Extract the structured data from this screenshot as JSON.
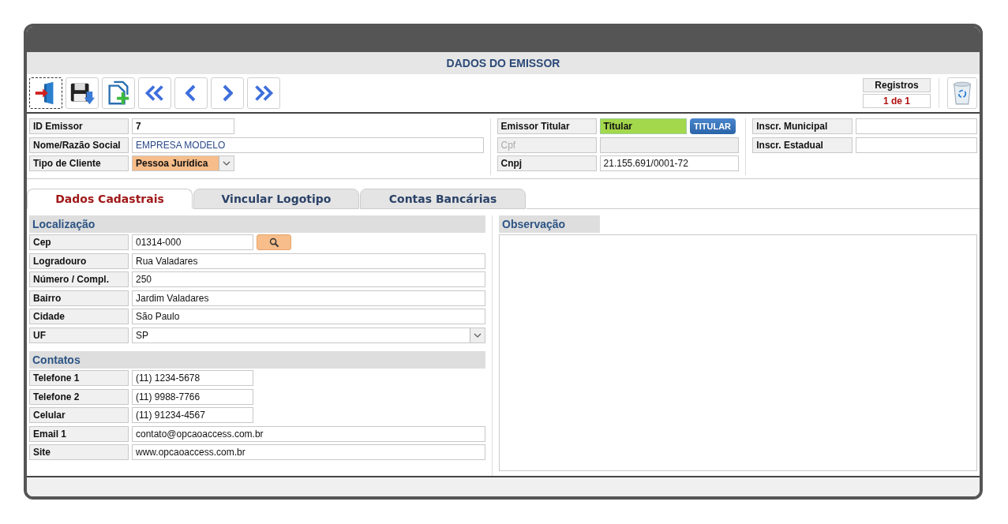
{
  "window": {
    "title": "DADOS DO EMISSOR"
  },
  "toolbar": [
    {
      "kind": "exit",
      "focused": true
    },
    {
      "kind": "save",
      "focused": false
    },
    {
      "kind": "new",
      "focused": false
    },
    {
      "kind": "first",
      "focused": false
    },
    {
      "kind": "prev",
      "focused": false
    },
    {
      "kind": "next",
      "focused": false
    },
    {
      "kind": "last",
      "focused": false
    }
  ],
  "records": {
    "label": "Registros",
    "value": "1 de 1"
  },
  "header": [
    {
      "fields": [
        {
          "label": "ID Emissor",
          "value": "7",
          "kind": "short",
          "disabled": false
        },
        {
          "label": "Nome/Razão Social",
          "value": "EMPRESA MODELO",
          "kind": "long",
          "disabled": false
        },
        {
          "label": "Tipo de Cliente",
          "value": "Pessoa Jurídica",
          "kind": "select",
          "color": "#f7bd8a",
          "disabled": false
        }
      ]
    },
    {
      "fields": [
        {
          "label": "Emissor Titular",
          "value": "Titular",
          "kind": "badge",
          "color": "#a4d84c",
          "button": "TITULAR",
          "disabled": false
        },
        {
          "label": "Cpf",
          "kind": "long",
          "disabled": true
        },
        {
          "label": "Cnpj",
          "value": "21.155.691/0001-72",
          "kind": "long",
          "disabled": false
        }
      ]
    },
    {
      "fields": [
        {
          "label": "Inscr. Municipal",
          "kind": "long",
          "disabled": false
        },
        {
          "label": "Inscr. Estadual",
          "kind": "long",
          "disabled": false
        }
      ]
    }
  ],
  "tabs": [
    {
      "label": "Dados Cadastrais",
      "selected": true
    },
    {
      "label": "Vincular Logotipo",
      "selected": false
    },
    {
      "label": "Contas Bancárias",
      "selected": false
    }
  ],
  "sections": [
    {
      "title": "Localização",
      "fields": [
        {
          "label": "Cep",
          "value": "01314-000",
          "kind": "search"
        },
        {
          "label": "Logradouro",
          "value": "Rua Valadares",
          "kind": "long"
        },
        {
          "label": "Número / Compl.",
          "value": "250",
          "kind": "long"
        },
        {
          "label": "Bairro",
          "value": "Jardim Valadares",
          "kind": "long"
        },
        {
          "label": "Cidade",
          "value": "São Paulo",
          "kind": "long"
        },
        {
          "label": "UF",
          "value": "SP",
          "kind": "select"
        }
      ]
    },
    {
      "title": "Contatos",
      "fields": [
        {
          "label": "Telefone 1",
          "value": "(11) 1234-5678",
          "kind": "short"
        },
        {
          "label": "Telefone 2",
          "value": "(11) 9988-7766",
          "kind": "short"
        },
        {
          "label": "Celular",
          "value": "(11) 91234-4567",
          "kind": "short"
        },
        {
          "label": "Email 1",
          "value": "contato@opcaoaccess.com.br",
          "kind": "long"
        },
        {
          "label": "Site",
          "value": "www.opcaoaccess.com.br",
          "kind": "long"
        }
      ]
    }
  ],
  "notes": {
    "title": "Observação"
  }
}
